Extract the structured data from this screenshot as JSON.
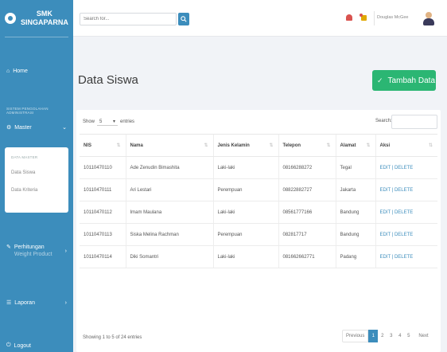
{
  "brand": {
    "line1": "SMK",
    "line2": "SINGAPARNA"
  },
  "sidebar": {
    "home": "Home",
    "heading": "SISTEM PENGOLAHAN ADMINISTRASI",
    "master": "Master",
    "submenu": {
      "heading": "DATA MASTER",
      "items": [
        {
          "label": "Data Siswa"
        },
        {
          "label": "Data Kriteria"
        }
      ]
    },
    "transaksi": {
      "label": "Perhitungan",
      "sub": "Weight Product"
    },
    "laporan": "Laporan",
    "logout": "Logout"
  },
  "topbar": {
    "search_placeholder": "Search for...",
    "user_name": "Douglas McGee"
  },
  "page": {
    "title": "Data Siswa",
    "add_button": "Tambah Data"
  },
  "table_controls": {
    "show_label": "Show",
    "show_value": "5",
    "entries_label": "entries",
    "search_label": "Search:"
  },
  "table": {
    "headers": [
      "NIS",
      "Nama",
      "Jenis Kelamin",
      "Telepon",
      "Alamat",
      "Aksi"
    ],
    "rows": [
      {
        "nis": "10110470110",
        "nama": "Ade Zenudin Bimashita",
        "jk": "Laki-laki",
        "telepon": "08166288272",
        "alamat": "Tegal",
        "edit": "EDIT",
        "sep": " | ",
        "delete": "DELETE"
      },
      {
        "nis": "10110470111",
        "nama": "Ari Lestari",
        "jk": "Perempuan",
        "telepon": "08822882727",
        "alamat": "Jakarta",
        "edit": "EDIT",
        "sep": " | ",
        "delete": "DELETE"
      },
      {
        "nis": "10110470112",
        "nama": "Imam Maulana",
        "jk": "Laki-laki",
        "telepon": "08561777166",
        "alamat": "Bandung",
        "edit": "EDIT",
        "sep": " | ",
        "delete": "DELETE"
      },
      {
        "nis": "10110470113",
        "nama": "Siska Melina Rachman",
        "jk": "Perempuan",
        "telepon": "082817717",
        "alamat": "Bandung",
        "edit": "EDIT",
        "sep": " | ",
        "delete": "DELETE"
      },
      {
        "nis": "10110470114",
        "nama": "Diki Somantri",
        "jk": "Laki-laki",
        "telepon": "081662662771",
        "alamat": "Padang",
        "edit": "EDIT",
        "sep": " | ",
        "delete": "DELETE"
      }
    ]
  },
  "footer": {
    "info": "Showing 1 to 5 of 24 entries",
    "pagination": {
      "prev": "Previous",
      "pages": [
        "1",
        "2",
        "3",
        "4",
        "5"
      ],
      "next": "Next"
    }
  },
  "colors": {
    "primary": "#3c8dbc",
    "success": "#2bb673",
    "danger": "#d9534f",
    "warning": "#e0a800"
  }
}
